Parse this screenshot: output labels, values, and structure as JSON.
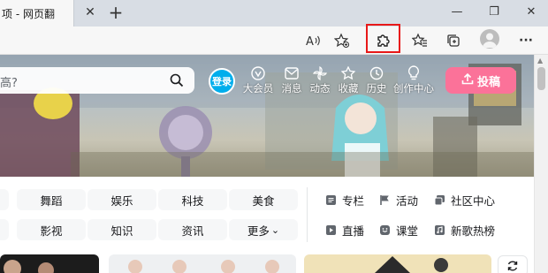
{
  "browser": {
    "tab_title": "项 - 网页翻",
    "tab_close": "✕",
    "new_tab": "+",
    "minimize": "—",
    "restore": "❐",
    "close": "✕",
    "more_menu": "···"
  },
  "site": {
    "search_placeholder": "高?",
    "login_label": "登录",
    "nav": [
      {
        "label": "大会员",
        "icon": "vip-icon"
      },
      {
        "label": "消息",
        "icon": "message-icon"
      },
      {
        "label": "动态",
        "icon": "dynamic-icon"
      },
      {
        "label": "收藏",
        "icon": "favorite-icon"
      },
      {
        "label": "历史",
        "icon": "history-icon"
      },
      {
        "label": "创作中心",
        "icon": "creator-icon"
      }
    ],
    "upload_label": "投稿",
    "channels": {
      "row1": [
        "舞蹈",
        "娱乐",
        "科技",
        "美食"
      ],
      "row2": [
        "影视",
        "知识",
        "资讯",
        "更多"
      ],
      "more_chevron": "⌄"
    },
    "side_links": [
      {
        "label": "专栏",
        "icon": "column-icon"
      },
      {
        "label": "活动",
        "icon": "activity-icon"
      },
      {
        "label": "社区中心",
        "icon": "community-icon"
      },
      {
        "label": "直播",
        "icon": "live-icon"
      },
      {
        "label": "课堂",
        "icon": "classroom-icon"
      },
      {
        "label": "新歌热榜",
        "icon": "music-icon"
      }
    ]
  },
  "colors": {
    "login_blue": "#00aeec",
    "upload_pink": "#fb7299",
    "highlight_red": "#e81818"
  }
}
